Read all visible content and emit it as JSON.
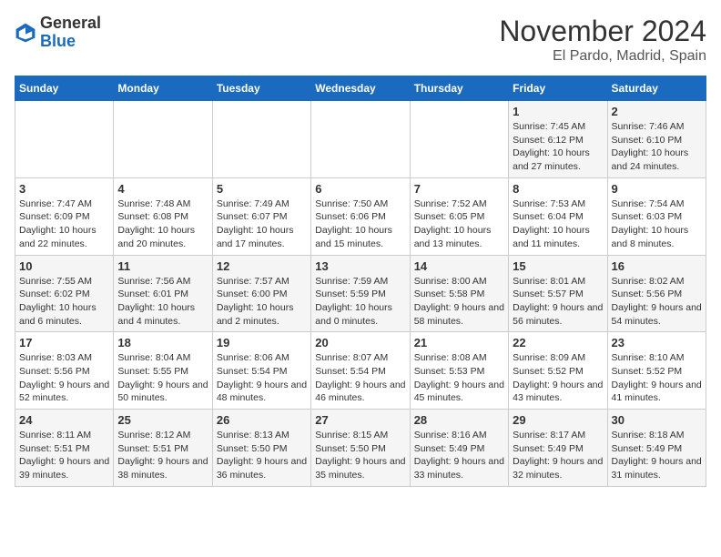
{
  "logo": {
    "general": "General",
    "blue": "Blue"
  },
  "header": {
    "month": "November 2024",
    "location": "El Pardo, Madrid, Spain"
  },
  "weekdays": [
    "Sunday",
    "Monday",
    "Tuesday",
    "Wednesday",
    "Thursday",
    "Friday",
    "Saturday"
  ],
  "weeks": [
    [
      {
        "day": "",
        "info": ""
      },
      {
        "day": "",
        "info": ""
      },
      {
        "day": "",
        "info": ""
      },
      {
        "day": "",
        "info": ""
      },
      {
        "day": "",
        "info": ""
      },
      {
        "day": "1",
        "info": "Sunrise: 7:45 AM\nSunset: 6:12 PM\nDaylight: 10 hours and 27 minutes."
      },
      {
        "day": "2",
        "info": "Sunrise: 7:46 AM\nSunset: 6:10 PM\nDaylight: 10 hours and 24 minutes."
      }
    ],
    [
      {
        "day": "3",
        "info": "Sunrise: 7:47 AM\nSunset: 6:09 PM\nDaylight: 10 hours and 22 minutes."
      },
      {
        "day": "4",
        "info": "Sunrise: 7:48 AM\nSunset: 6:08 PM\nDaylight: 10 hours and 20 minutes."
      },
      {
        "day": "5",
        "info": "Sunrise: 7:49 AM\nSunset: 6:07 PM\nDaylight: 10 hours and 17 minutes."
      },
      {
        "day": "6",
        "info": "Sunrise: 7:50 AM\nSunset: 6:06 PM\nDaylight: 10 hours and 15 minutes."
      },
      {
        "day": "7",
        "info": "Sunrise: 7:52 AM\nSunset: 6:05 PM\nDaylight: 10 hours and 13 minutes."
      },
      {
        "day": "8",
        "info": "Sunrise: 7:53 AM\nSunset: 6:04 PM\nDaylight: 10 hours and 11 minutes."
      },
      {
        "day": "9",
        "info": "Sunrise: 7:54 AM\nSunset: 6:03 PM\nDaylight: 10 hours and 8 minutes."
      }
    ],
    [
      {
        "day": "10",
        "info": "Sunrise: 7:55 AM\nSunset: 6:02 PM\nDaylight: 10 hours and 6 minutes."
      },
      {
        "day": "11",
        "info": "Sunrise: 7:56 AM\nSunset: 6:01 PM\nDaylight: 10 hours and 4 minutes."
      },
      {
        "day": "12",
        "info": "Sunrise: 7:57 AM\nSunset: 6:00 PM\nDaylight: 10 hours and 2 minutes."
      },
      {
        "day": "13",
        "info": "Sunrise: 7:59 AM\nSunset: 5:59 PM\nDaylight: 10 hours and 0 minutes."
      },
      {
        "day": "14",
        "info": "Sunrise: 8:00 AM\nSunset: 5:58 PM\nDaylight: 9 hours and 58 minutes."
      },
      {
        "day": "15",
        "info": "Sunrise: 8:01 AM\nSunset: 5:57 PM\nDaylight: 9 hours and 56 minutes."
      },
      {
        "day": "16",
        "info": "Sunrise: 8:02 AM\nSunset: 5:56 PM\nDaylight: 9 hours and 54 minutes."
      }
    ],
    [
      {
        "day": "17",
        "info": "Sunrise: 8:03 AM\nSunset: 5:56 PM\nDaylight: 9 hours and 52 minutes."
      },
      {
        "day": "18",
        "info": "Sunrise: 8:04 AM\nSunset: 5:55 PM\nDaylight: 9 hours and 50 minutes."
      },
      {
        "day": "19",
        "info": "Sunrise: 8:06 AM\nSunset: 5:54 PM\nDaylight: 9 hours and 48 minutes."
      },
      {
        "day": "20",
        "info": "Sunrise: 8:07 AM\nSunset: 5:54 PM\nDaylight: 9 hours and 46 minutes."
      },
      {
        "day": "21",
        "info": "Sunrise: 8:08 AM\nSunset: 5:53 PM\nDaylight: 9 hours and 45 minutes."
      },
      {
        "day": "22",
        "info": "Sunrise: 8:09 AM\nSunset: 5:52 PM\nDaylight: 9 hours and 43 minutes."
      },
      {
        "day": "23",
        "info": "Sunrise: 8:10 AM\nSunset: 5:52 PM\nDaylight: 9 hours and 41 minutes."
      }
    ],
    [
      {
        "day": "24",
        "info": "Sunrise: 8:11 AM\nSunset: 5:51 PM\nDaylight: 9 hours and 39 minutes."
      },
      {
        "day": "25",
        "info": "Sunrise: 8:12 AM\nSunset: 5:51 PM\nDaylight: 9 hours and 38 minutes."
      },
      {
        "day": "26",
        "info": "Sunrise: 8:13 AM\nSunset: 5:50 PM\nDaylight: 9 hours and 36 minutes."
      },
      {
        "day": "27",
        "info": "Sunrise: 8:15 AM\nSunset: 5:50 PM\nDaylight: 9 hours and 35 minutes."
      },
      {
        "day": "28",
        "info": "Sunrise: 8:16 AM\nSunset: 5:49 PM\nDaylight: 9 hours and 33 minutes."
      },
      {
        "day": "29",
        "info": "Sunrise: 8:17 AM\nSunset: 5:49 PM\nDaylight: 9 hours and 32 minutes."
      },
      {
        "day": "30",
        "info": "Sunrise: 8:18 AM\nSunset: 5:49 PM\nDaylight: 9 hours and 31 minutes."
      }
    ]
  ]
}
